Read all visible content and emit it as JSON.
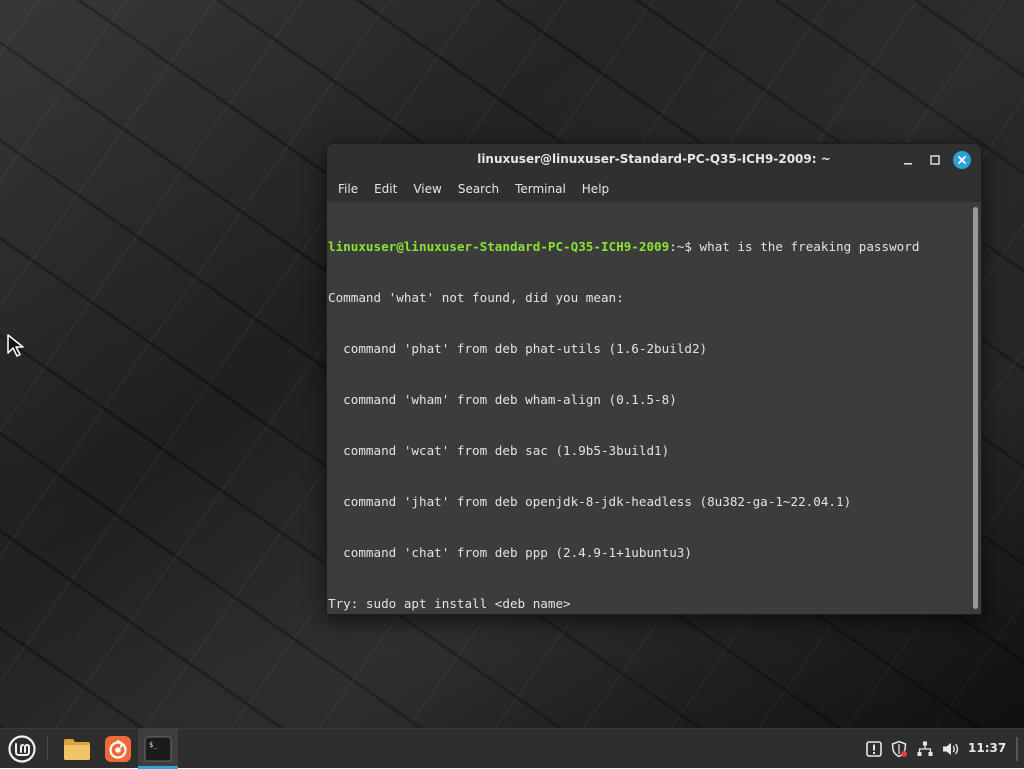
{
  "window": {
    "title": "linuxuser@linuxuser-Standard-PC-Q35-ICH9-2009: ~"
  },
  "menu": {
    "items": [
      "File",
      "Edit",
      "View",
      "Search",
      "Terminal",
      "Help"
    ]
  },
  "terminal": {
    "prompt": "linuxuser@linuxuser-Standard-PC-Q35-ICH9-2009",
    "path_suffix": ":~$ ",
    "command": "what is the freaking password",
    "output": [
      "Command 'what' not found, did you mean:",
      "  command 'phat' from deb phat-utils (1.6-2build2)",
      "  command 'wham' from deb wham-align (0.1.5-8)",
      "  command 'wcat' from deb sac (1.9b5-3build1)",
      "  command 'jhat' from deb openjdk-8-jdk-headless (8u382-ga-1~22.04.1)",
      "  command 'chat' from deb ppp (2.4.9-1+1ubuntu3)",
      "Try: sudo apt install <deb name>"
    ]
  },
  "taskbar": {
    "clock": "11:37",
    "launchers": [
      "mint-menu-icon",
      "folder-icon",
      "firefox-icon",
      "terminal-icon"
    ],
    "tray": [
      "update-manager-icon",
      "shield-icon",
      "network-icon",
      "volume-icon"
    ]
  },
  "colors": {
    "prompt": "#8ae234",
    "terminal_bg": "#3c3c3c",
    "accent": "#35a4db",
    "close_button": "#2f9fd8"
  }
}
